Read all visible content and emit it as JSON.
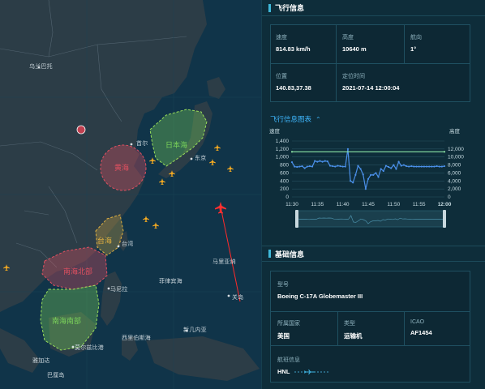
{
  "map": {
    "labels": [
      {
        "key": "l1",
        "text": "乌兰巴托"
      },
      {
        "key": "l2",
        "text": "东京"
      },
      {
        "key": "l3",
        "text": "首尔"
      },
      {
        "key": "l4",
        "text": "台湾"
      },
      {
        "key": "l5",
        "text": "马尼拉"
      },
      {
        "key": "l6",
        "text": "西里伯斯海"
      },
      {
        "key": "l7",
        "text": "新几内亚"
      },
      {
        "key": "l8",
        "text": "莫尔兹比港"
      },
      {
        "key": "l9",
        "text": "雅加达"
      },
      {
        "key": "l10",
        "text": "巴厘岛"
      },
      {
        "key": "l11",
        "text": "菲律宾海"
      },
      {
        "key": "l12",
        "text": "马里亚纳"
      },
      {
        "key": "l13",
        "text": "关岛"
      }
    ],
    "zones": [
      {
        "key": "z1",
        "text": "日本海",
        "color": "#7bd35a"
      },
      {
        "key": "z2",
        "text": "黄海",
        "color": "#e05060"
      },
      {
        "key": "z3",
        "text": "台海",
        "color": "#e0b040"
      },
      {
        "key": "z4",
        "text": "南海北部",
        "color": "#e05060"
      },
      {
        "key": "z5",
        "text": "南海南部",
        "color": "#7bd35a"
      }
    ]
  },
  "flight_info": {
    "title": "飞行信息",
    "speed_label": "速度",
    "speed_value": "814.83 km/h",
    "altitude_label": "高度",
    "altitude_value": "10640 m",
    "heading_label": "航向",
    "heading_value": "1°",
    "position_label": "位置",
    "position_value": "140.83,37.38",
    "time_label": "定位时间",
    "time_value": "2021-07-14 12:00:04"
  },
  "chart": {
    "title": "飞行信息图表",
    "left_axis_label": "速度",
    "right_axis_label": "高度"
  },
  "chart_data": {
    "type": "line",
    "x": [
      "11:30",
      "11:35",
      "11:40",
      "11:45",
      "11:50",
      "11:55",
      "12:00"
    ],
    "y_left_ticks": [
      0,
      200,
      400,
      600,
      800,
      1000,
      1200,
      1400
    ],
    "y_right_ticks": [
      0,
      2000,
      4000,
      6000,
      8000,
      10000,
      12000
    ],
    "ylim_left": [
      0,
      1400
    ],
    "ylim_right": [
      0,
      14000
    ],
    "series": [
      {
        "name": "速度",
        "axis": "left",
        "color": "#4a8fe8",
        "x": [
          0,
          0.5,
          1,
          1.5,
          2,
          2.5,
          3,
          3.5,
          4,
          4.5,
          5,
          5.5,
          6,
          6.5,
          7,
          7.5,
          8,
          8.5,
          9,
          9.5,
          10,
          10.5,
          11,
          11.5,
          12,
          12.5,
          13,
          13.5,
          14,
          14.5,
          15,
          15.5,
          16,
          16.5,
          17,
          17.5,
          18,
          18.5,
          19,
          19.5,
          20,
          20.5,
          21,
          21.5,
          22,
          22.5,
          23,
          23.5,
          24,
          24.5,
          25,
          25.5,
          26,
          26.5,
          27,
          27.5,
          28,
          28.5,
          29,
          29.5,
          30
        ],
        "values": [
          870,
          760,
          750,
          760,
          770,
          720,
          760,
          770,
          760,
          900,
          880,
          900,
          880,
          900,
          890,
          780,
          770,
          760,
          780,
          770,
          760,
          760,
          1200,
          400,
          360,
          550,
          780,
          700,
          560,
          200,
          450,
          550,
          550,
          600,
          500,
          700,
          650,
          780,
          750,
          720,
          800,
          700,
          880,
          780,
          800,
          770,
          760,
          770,
          760,
          760,
          760,
          760,
          760,
          760,
          760,
          760,
          760,
          770,
          760,
          760,
          770
        ]
      },
      {
        "name": "高度",
        "axis": "right",
        "color": "#8fe8a8",
        "x": [
          0,
          30
        ],
        "values": [
          11300,
          11300
        ]
      }
    ],
    "legend": "none",
    "grid": true
  },
  "basic_info": {
    "title": "基础信息",
    "model_label": "型号",
    "model_value": "Boeing C-17A Globemaster III",
    "country_label": "所属国家",
    "country_value": "美国",
    "type_label": "类型",
    "type_value": "运输机",
    "icao_label": "ICAO",
    "icao_value": "AF1454",
    "route_label": "航班信息",
    "route_origin": "HNL"
  }
}
